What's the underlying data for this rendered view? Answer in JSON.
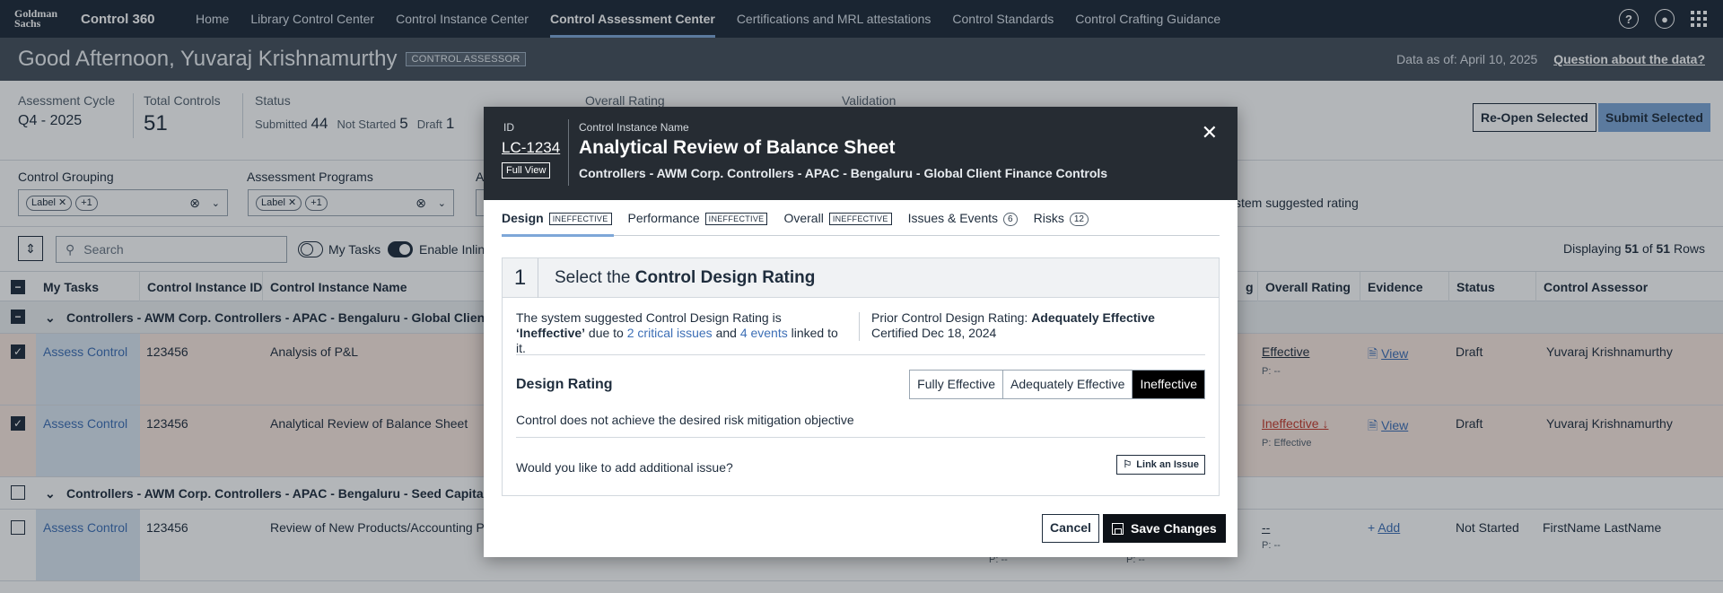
{
  "nav": {
    "logo": "Goldman Sachs",
    "app_name": "Control 360",
    "items": [
      {
        "label": "Home"
      },
      {
        "label": "Library Control Center"
      },
      {
        "label": "Control Instance Center"
      },
      {
        "label": "Control Assessment Center",
        "active": true
      },
      {
        "label": "Certifications and MRL attestations"
      },
      {
        "label": "Control Standards"
      },
      {
        "label": "Control Crafting Guidance"
      }
    ],
    "icons": [
      "help-icon",
      "user-icon",
      "apps-grid-icon"
    ]
  },
  "greeting": {
    "text": "Good Afternoon, Yuvaraj Krishnamurthy",
    "role": "CONTROL ASSESSOR",
    "as_of": "Data as of: April 10, 2025",
    "question_link": "Question about the data?"
  },
  "summary": {
    "cycle_label": "Asessment Cycle",
    "cycle_value": "Q4 - 2025",
    "total_label": "Total Controls",
    "total_value": "51",
    "status_label": "Status",
    "status": [
      {
        "label": "Submitted",
        "count": "44"
      },
      {
        "label": "Not Started",
        "count": "5"
      },
      {
        "label": "Draft",
        "count": "1"
      }
    ],
    "overall_label": "Overall Rating",
    "validation_label": "Validation",
    "reopen": "Re-Open Selected",
    "submit": "Submit Selected"
  },
  "filters": {
    "grouping_label": "Control Grouping",
    "programs_label": "Assessment Programs",
    "chip": "Label",
    "more": "+1",
    "stem_text": "stem suggested rating"
  },
  "toolbar": {
    "search_placeholder": "Search",
    "my_tasks": "My Tasks",
    "enable_inline": "Enable Inlin",
    "displaying_pre": "Displaying",
    "displaying_count": "51",
    "displaying_mid": "of",
    "displaying_total": "51",
    "displaying_post": "Rows"
  },
  "table": {
    "headers": {
      "my_tasks": "My Tasks",
      "ci_id": "Control Instance ID",
      "ci_name": "Control Instance Name",
      "g": "g",
      "overall": "Overall Rating",
      "evidence": "Evidence",
      "status": "Status",
      "assessor": "Control Assessor"
    },
    "group1": "Controllers - AWM Corp. Controllers - APAC - Bengaluru - Global Client Fin",
    "group2": "Controllers - AWM Corp. Controllers - APAC - Bengaluru - Seed Capital Re",
    "rows": [
      {
        "task": "Assess Control",
        "id": "123456",
        "name": "Analysis of P&L",
        "overall": "Effective",
        "prior": "P: --",
        "evidence": "View",
        "status": "Draft",
        "assessor": "Yuvaraj Krishnamurthy"
      },
      {
        "task": "Assess Control",
        "id": "123456",
        "name": "Analytical Review of Balance Sheet",
        "overall": "Ineffective",
        "prior": "P: Effective",
        "evidence": "View",
        "status": "Draft",
        "assessor": "Yuvaraj Krishnamurthy"
      },
      {
        "task": "Assess Control",
        "id": "123456",
        "name": "Review of New Products/Accounting P",
        "overall": "--",
        "prior": "P: --",
        "evidence": "Add",
        "status": "Not Started",
        "assessor": "FirstName LastName",
        "extra_p1": "P: --",
        "extra_p2": "P: --"
      }
    ]
  },
  "modal": {
    "id_label": "ID",
    "id_value": "LC-1234",
    "full_view": "Full View",
    "name_label": "Control Instance Name",
    "title": "Analytical Review of Balance Sheet",
    "path": "Controllers - AWM Corp. Controllers - APAC - Bengaluru - Global Client Finance Controls",
    "tabs": [
      {
        "label": "Design",
        "badge": "INEFFECTIVE",
        "active": true
      },
      {
        "label": "Performance",
        "badge": "INEFFECTIVE"
      },
      {
        "label": "Overall",
        "badge": "INEFFECTIVE"
      },
      {
        "label": "Issues & Events",
        "count": "6"
      },
      {
        "label": "Risks",
        "count": "12"
      }
    ],
    "step_number": "1",
    "step_title_pre": "Select the",
    "step_title_bold": "Control Design Rating",
    "sys_pre": "The system suggested Control Design Rating is",
    "sys_rating": "‘Ineffective’",
    "sys_due": "due to",
    "issues_link": "2 critical issues",
    "and": "and",
    "events_link": "4 events",
    "linked": "linked to it.",
    "prior_label": "Prior Control Design Rating:",
    "prior_value": "Adequately Effective",
    "certified": "Certified Dec 18, 2024",
    "design_rating": "Design Rating",
    "options": [
      "Fully Effective",
      "Adequately Effective",
      "Ineffective"
    ],
    "selected_option": "Ineffective",
    "description": "Control does not achieve the desired risk mitigation objective",
    "add_issue_q": "Would you like to add additional issue?",
    "link_issue": "Link an Issue",
    "cancel": "Cancel",
    "save": "Save Changes"
  }
}
